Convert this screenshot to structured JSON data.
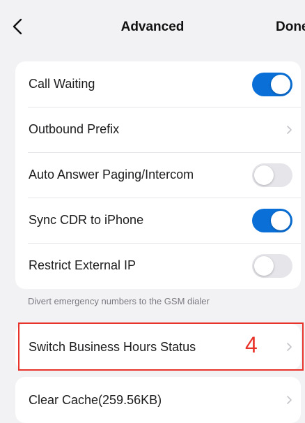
{
  "nav": {
    "title": "Advanced",
    "done_label": "Done"
  },
  "settings": {
    "rows": [
      {
        "label": "Call Waiting",
        "type": "toggle",
        "value": true
      },
      {
        "label": "Outbound Prefix",
        "type": "chevron"
      },
      {
        "label": "Auto Answer Paging/Intercom",
        "type": "toggle",
        "value": false
      },
      {
        "label": "Sync CDR to iPhone",
        "type": "toggle",
        "value": true
      },
      {
        "label": "Restrict External IP",
        "type": "toggle",
        "value": false
      }
    ],
    "footnote": "Divert emergency numbers to the GSM dialer"
  },
  "business_hours": {
    "label": "Switch Business Hours Status"
  },
  "cache": {
    "label": "Clear Cache(259.56KB)"
  },
  "annotation": {
    "step_number": "4",
    "color": "#e8332a"
  },
  "colors": {
    "toggle_on": "#0a6fd6",
    "toggle_off": "#e5e5ea",
    "background": "#f2f2f4"
  }
}
